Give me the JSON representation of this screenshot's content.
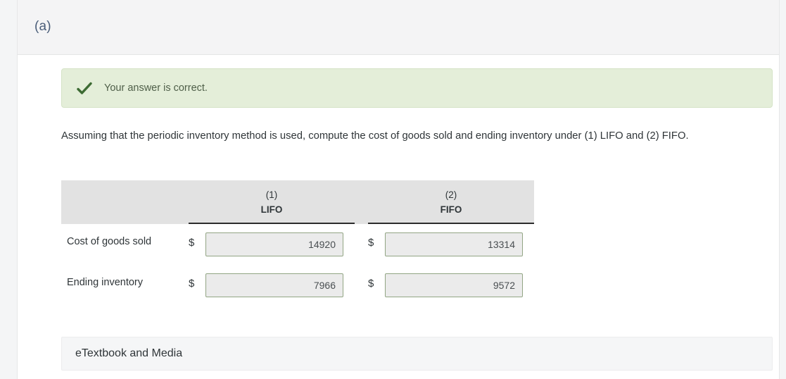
{
  "part": {
    "label": "(a)"
  },
  "banner": {
    "icon": "check-icon",
    "message": "Your answer is correct.",
    "background_color": "#e4eed9",
    "text_color": "#4f5f49",
    "check_color": "#3d6b33"
  },
  "prompt": {
    "text": "Assuming that the periodic inventory method is used, compute the cost of goods sold and ending inventory under (1) LIFO and (2) FIFO."
  },
  "table": {
    "columns": [
      {
        "number": "(1)",
        "name": "LIFO"
      },
      {
        "number": "(2)",
        "name": "FIFO"
      }
    ],
    "currency_symbol": "$",
    "rows": [
      {
        "label": "Cost of goods sold",
        "values": [
          "14920",
          "13314"
        ]
      },
      {
        "label": "Ending inventory",
        "values": [
          "7966",
          "9572"
        ]
      }
    ]
  },
  "etextbook": {
    "label": "eTextbook and Media"
  }
}
